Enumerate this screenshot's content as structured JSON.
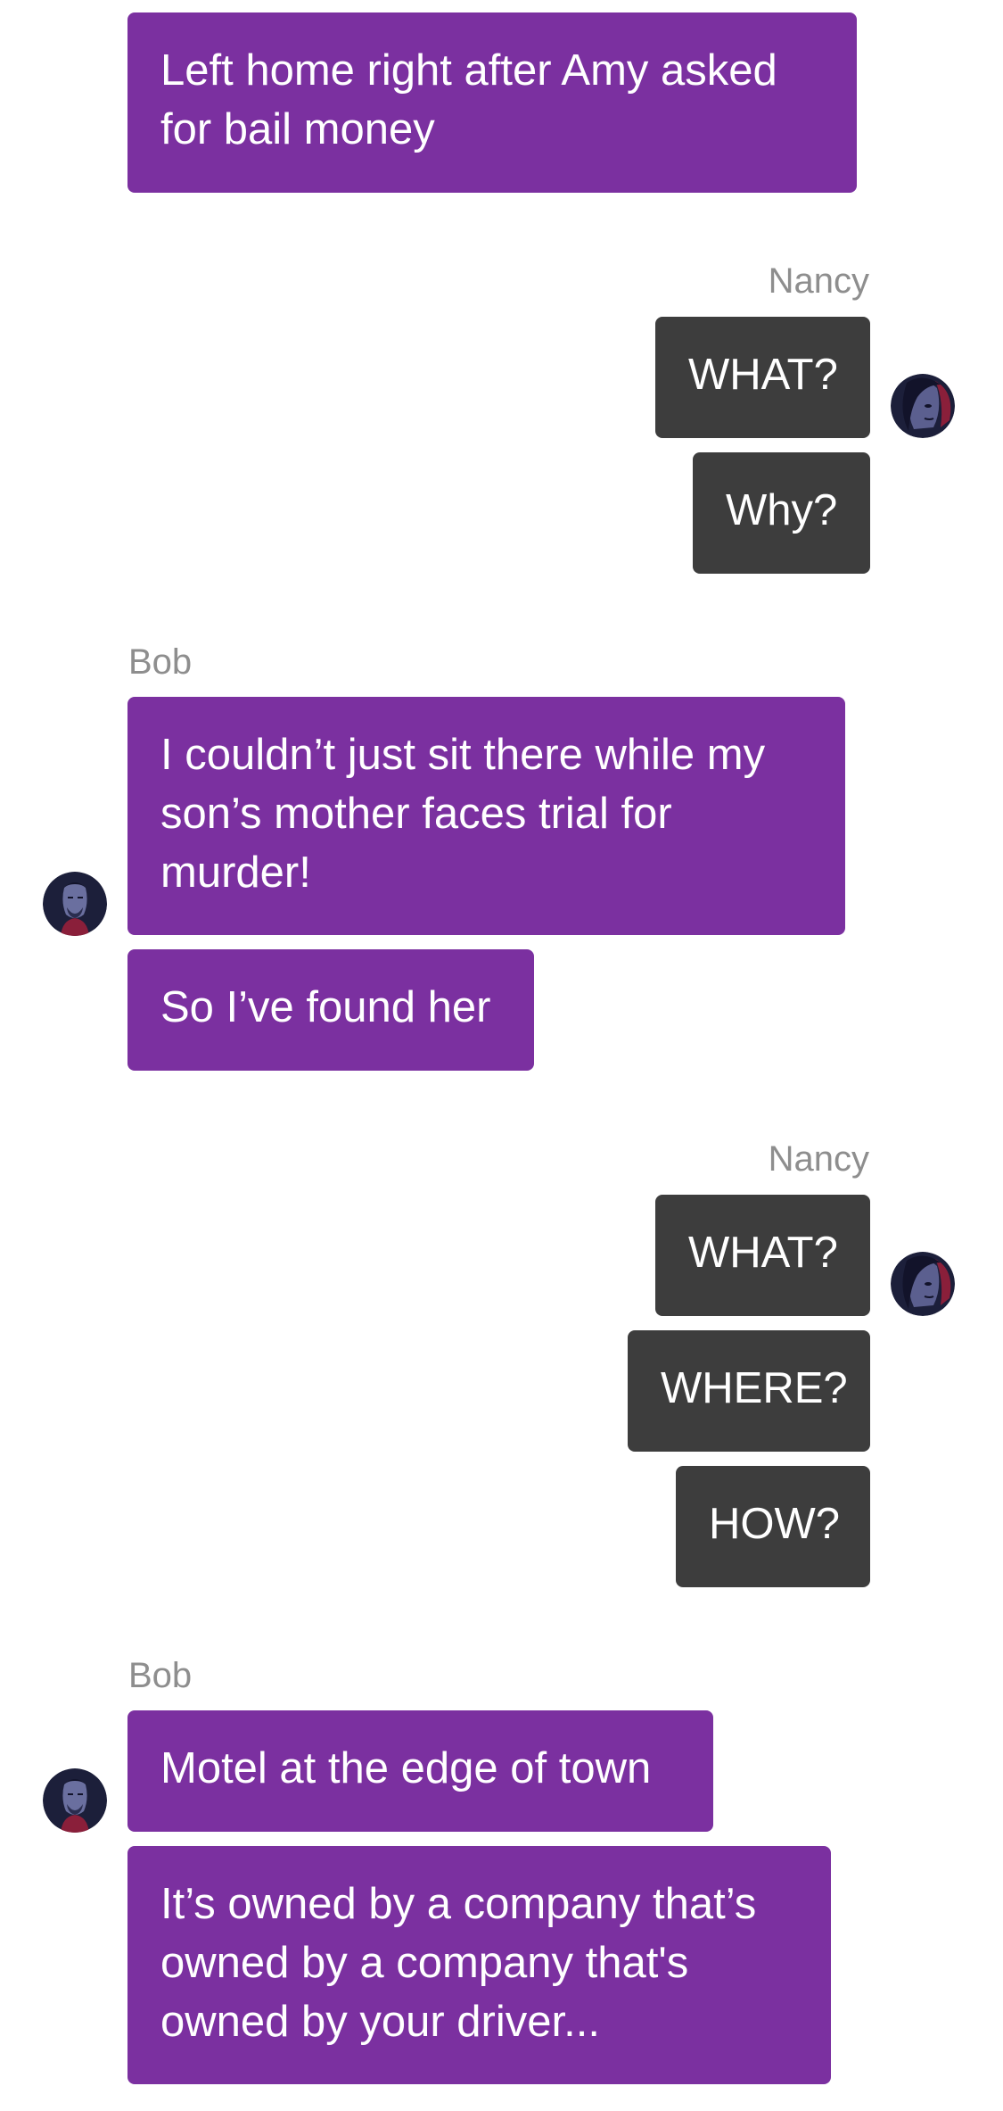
{
  "chat": {
    "messages": [
      {
        "sender": "Bob",
        "text": "Left home right after Amy asked for bail money"
      },
      {
        "sender": "Nancy",
        "text": "WHAT?"
      },
      {
        "sender": "Nancy",
        "text": "Why?"
      },
      {
        "sender": "Bob",
        "text": "I couldn’t just sit there while my son’s mother faces trial for murder!"
      },
      {
        "sender": "Bob",
        "text": "So I’ve found her"
      },
      {
        "sender": "Nancy",
        "text": "WHAT?"
      },
      {
        "sender": "Nancy",
        "text": "WHERE?"
      },
      {
        "sender": "Nancy",
        "text": "HOW?"
      },
      {
        "sender": "Bob",
        "text": "Motel at the edge of town"
      },
      {
        "sender": "Bob",
        "text": "It’s owned by a company that’s owned by a company that's owned by your driver..."
      }
    ],
    "groups": [
      {
        "sender_label": "Nancy"
      },
      {
        "sender_label": "Bob"
      },
      {
        "sender_label": "Nancy"
      },
      {
        "sender_label": "Bob"
      }
    ]
  },
  "colors": {
    "bob_bubble": "#7b30a0",
    "nancy_bubble": "#3d3d3d",
    "sender_label": "#8e8e8e",
    "background": "#ffffff"
  },
  "icons": {
    "bob_avatar": "bob-avatar-icon",
    "nancy_avatar": "nancy-avatar-icon"
  }
}
